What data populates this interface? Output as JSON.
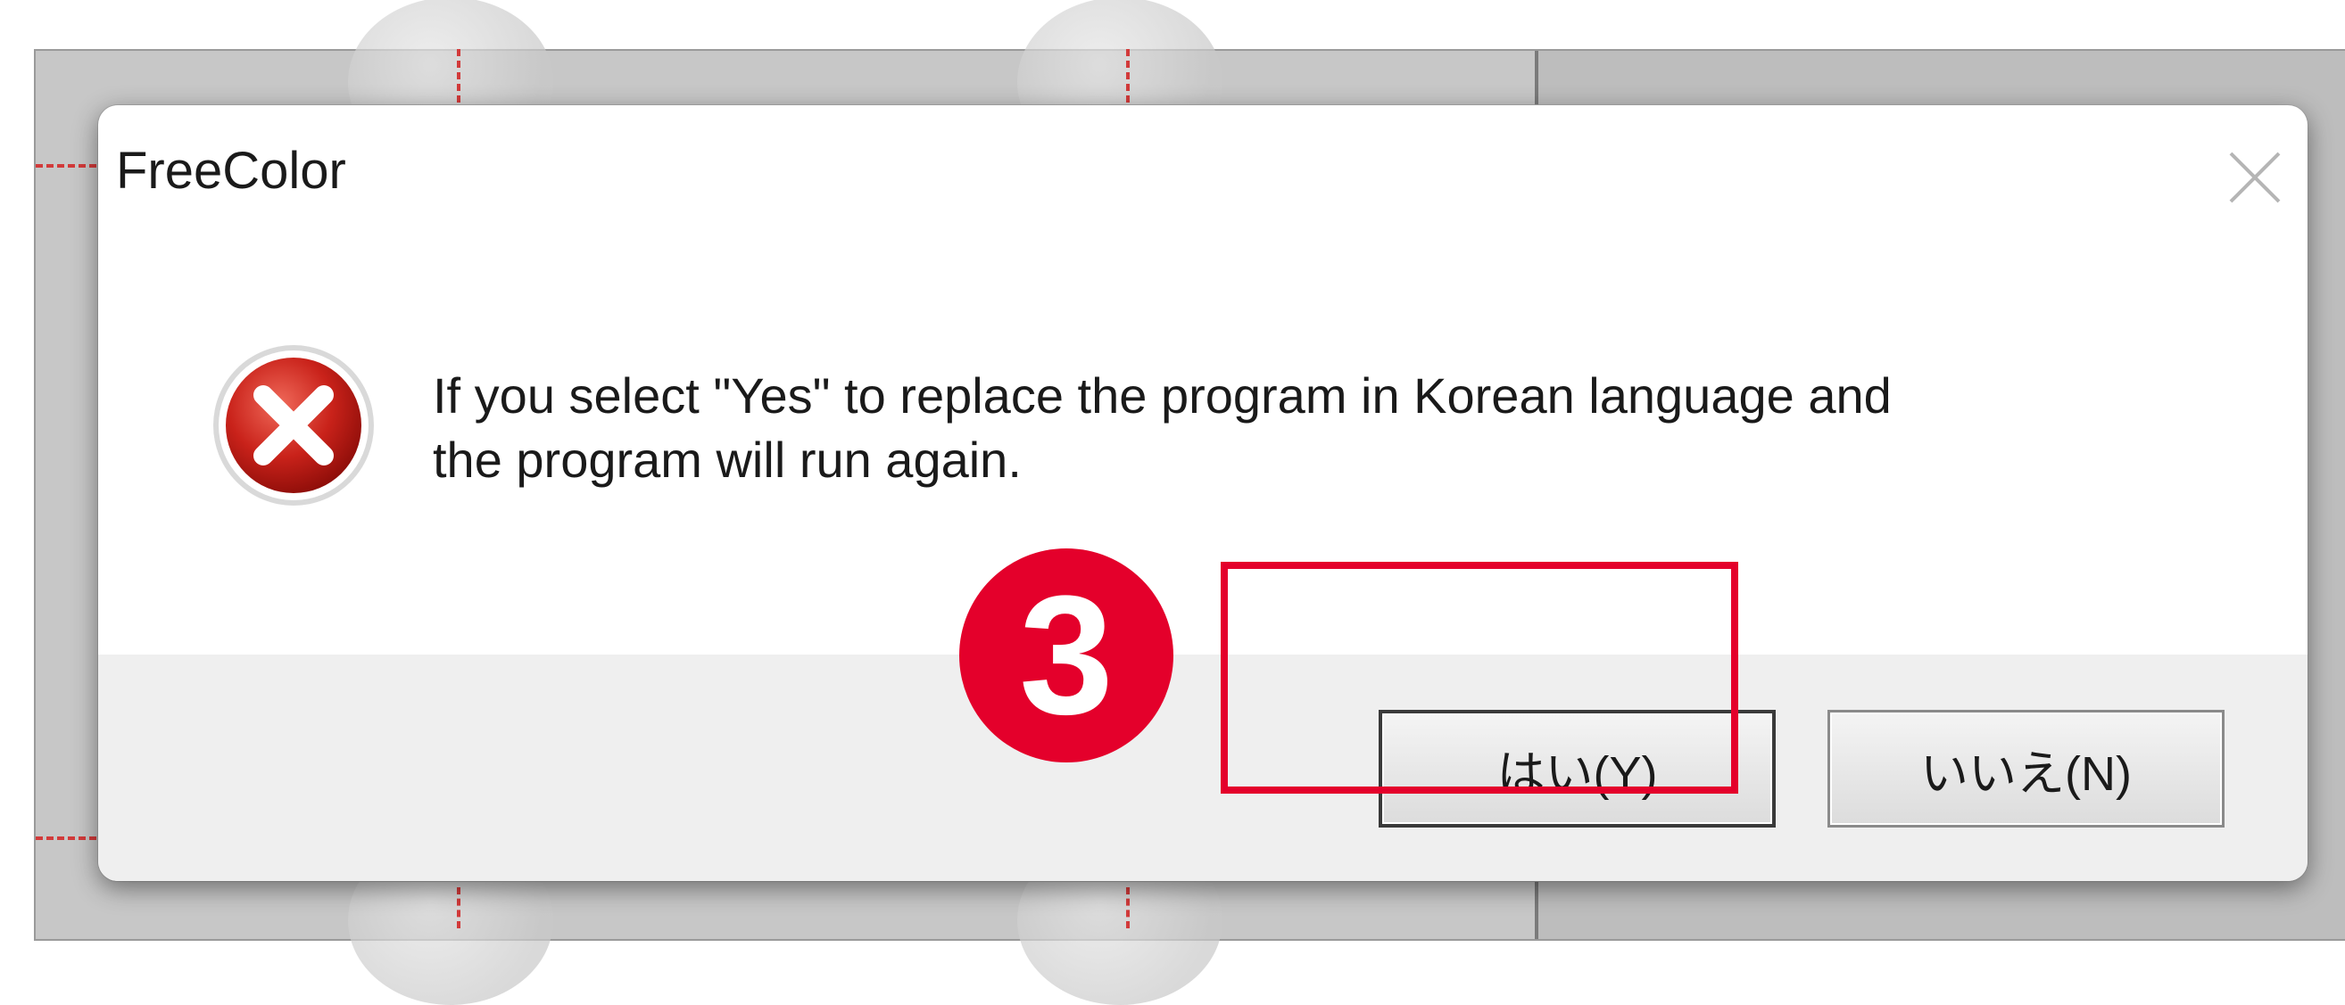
{
  "dialog": {
    "title": "FreeColor",
    "message_line1": "If you select \"Yes\" to replace the program in Korean language and",
    "message_line2": "the program will run again.",
    "icon": "error-icon",
    "close_icon": "close-icon",
    "yes_label": "はい(Y)",
    "no_label": "いいえ(N)"
  },
  "annotation": {
    "step_number": "3",
    "color": "#e4002b"
  }
}
